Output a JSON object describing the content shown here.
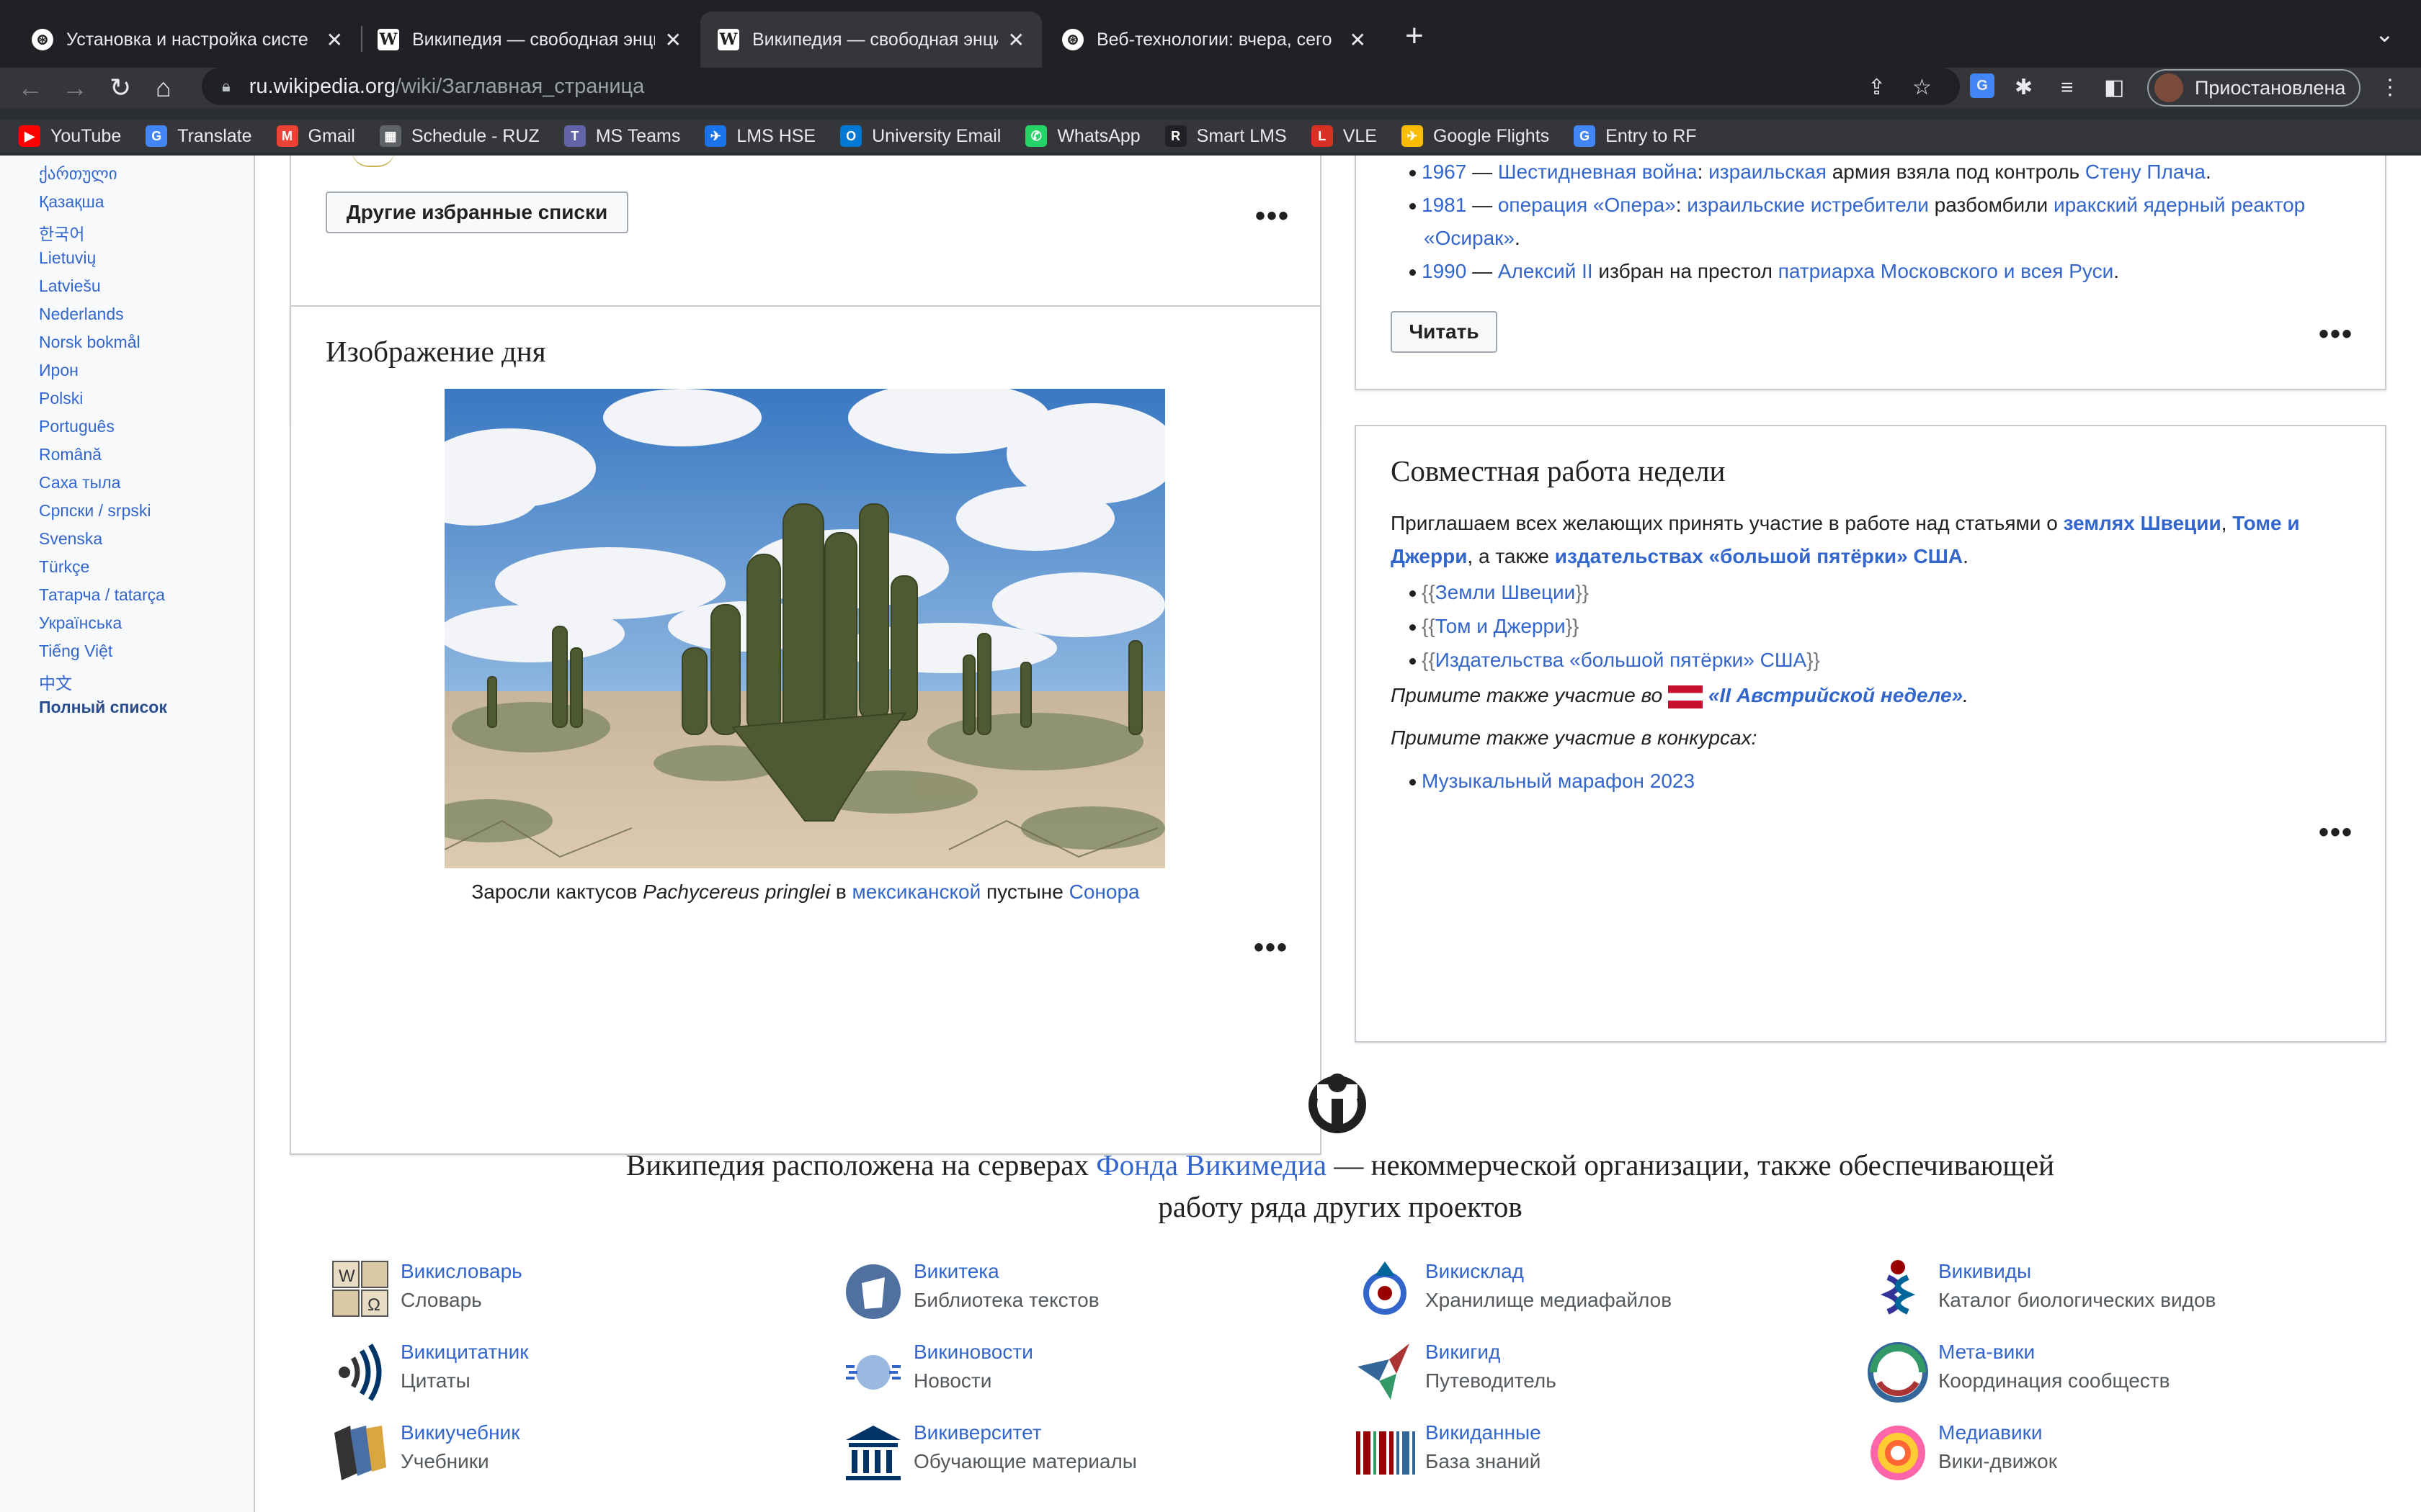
{
  "browser": {
    "tabs": [
      {
        "title": "Установка и настройка систе"
      },
      {
        "title": "Википедия — свободная энци"
      },
      {
        "title": "Википедия — свободная энци"
      },
      {
        "title": "Веб-технологии: вчера, сего"
      }
    ],
    "close_glyph": "✕",
    "new_tab_glyph": "+",
    "tab_menu_glyph": "⌄",
    "url_host": "ru.wikipedia.org",
    "url_path": "/wiki/Заглавная_страница",
    "profile_label": "Приостановлена",
    "bookmarks": [
      {
        "label": "YouTube",
        "color": "#ff0000",
        "glyph": "▶"
      },
      {
        "label": "Translate",
        "color": "#4285f4",
        "glyph": "G"
      },
      {
        "label": "Gmail",
        "color": "#ea4335",
        "glyph": "M"
      },
      {
        "label": "Schedule - RUZ",
        "color": "#5f6368",
        "glyph": "▦"
      },
      {
        "label": "MS Teams",
        "color": "#6264a7",
        "glyph": "T"
      },
      {
        "label": "LMS HSE",
        "color": "#1a73e8",
        "glyph": "✈"
      },
      {
        "label": "University Email",
        "color": "#0078d4",
        "glyph": "O"
      },
      {
        "label": "WhatsApp",
        "color": "#25d366",
        "glyph": "✆"
      },
      {
        "label": "Smart LMS",
        "color": "#202124",
        "glyph": "R"
      },
      {
        "label": "VLE",
        "color": "#d93025",
        "glyph": "L"
      },
      {
        "label": "Google Flights",
        "color": "#fbbc04",
        "glyph": "✈"
      },
      {
        "label": "Entry to RF",
        "color": "#4285f4",
        "glyph": "G"
      }
    ]
  },
  "sidebar": {
    "languages": [
      "ქართული",
      "Қазақша",
      "한국어",
      "Lietuvių",
      "Latviešu",
      "Nederlands",
      "Norsk bokmål",
      "Ирон",
      "Polski",
      "Português",
      "Română",
      "Саха тыла",
      "Српски / srpski",
      "Svenska",
      "Türkçe",
      "Татарча / tatarça",
      "Українська",
      "Tiếng Việt",
      "中文"
    ],
    "full_list": "Полный список"
  },
  "featured_lists": {
    "button": "Другие избранные списки",
    "more": "•••"
  },
  "image_of_day": {
    "title": "Изображение дня",
    "caption_pre": "Заросли кактусов ",
    "caption_italic": "Pachycereus pringlei",
    "caption_mid": " в ",
    "caption_link1": "мексиканской",
    "caption_mid2": " пустыне ",
    "caption_link2": "Сонора",
    "more": "•••"
  },
  "on_this_day": {
    "items": [
      {
        "year": "1967",
        "dash": " — ",
        "link": "Шестидневная война",
        "sep": ": ",
        "link2": "израильская",
        "text": " армия взяла под контроль ",
        "link3": "Стену Плача",
        "end": "."
      },
      {
        "year": "1981",
        "dash": " — ",
        "link": "операция «Опера»",
        "sep": ": ",
        "link2": "израильские истребители",
        "text": " разбомбили ",
        "link3": "иракский ядерный реактор",
        "cont": "«Осирак»",
        "end": "."
      },
      {
        "year": "1990",
        "dash": " — ",
        "link": "Алексий II",
        "text": " избран на престол ",
        "link3": "патриарха Московского и всея Руси",
        "end": "."
      }
    ],
    "button": "Читать",
    "more": "•••"
  },
  "collab": {
    "title": "Совместная работа недели",
    "intro_pre": "Приглашаем всех желающих принять участие в работе над статьями о ",
    "intro_l1": "землях Швеции",
    "intro_sep": ", ",
    "intro_l2a": "Томе и",
    "intro_l2b": "Джерри",
    "intro_mid": ", а также ",
    "intro_l3": "издательствах «большой пятёрки» США",
    "intro_end": ".",
    "templates": [
      "Земли Швеции",
      "Том и Джерри",
      "Издательства «большой пятёрки» США"
    ],
    "brace_open": "{{",
    "brace_close": "}}",
    "week_pre": "Примите также участие во ",
    "week_link": "«II Австрийской неделе»",
    "week_end": ".",
    "contests_label": "Примите также участие в конкурсах:",
    "contest": "Музыкальный марафон 2023",
    "more": "•••"
  },
  "footer": {
    "text_pre": "Википедия расположена на серверах ",
    "text_link": "Фонда Викимедиа",
    "text_post1": " — некоммерческой организации, также обеспечивающей",
    "text_post2": "работу ряда других проектов",
    "projects": [
      {
        "name": "Викисловарь",
        "desc": "Словарь"
      },
      {
        "name": "Викитека",
        "desc": "Библиотека текстов"
      },
      {
        "name": "Викисклад",
        "desc": "Хранилище медиафайлов"
      },
      {
        "name": "Викивиды",
        "desc": "Каталог биологических видов"
      },
      {
        "name": "Викицитатник",
        "desc": "Цитаты"
      },
      {
        "name": "Викиновости",
        "desc": "Новости"
      },
      {
        "name": "Викигид",
        "desc": "Путеводитель"
      },
      {
        "name": "Мета-вики",
        "desc": "Координация сообществ"
      },
      {
        "name": "Викиучебник",
        "desc": "Учебники"
      },
      {
        "name": "Викиверситет",
        "desc": "Обучающие материалы"
      },
      {
        "name": "Викиданные",
        "desc": "База знаний"
      },
      {
        "name": "Медиавики",
        "desc": "Вики-движок"
      }
    ]
  }
}
